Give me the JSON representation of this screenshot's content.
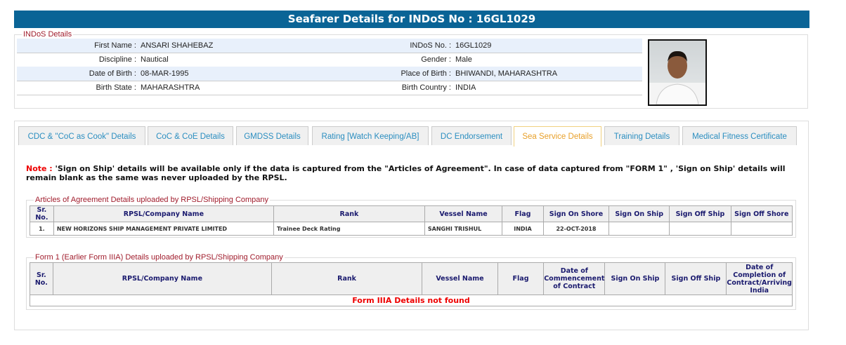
{
  "title": "Seafarer Details for INDoS No : 16GL1029",
  "indos": {
    "legend": "INDoS Details",
    "rows": [
      {
        "l1": "First Name :",
        "v1": "ANSARI SHAHEBAZ",
        "l2": "INDoS No. :",
        "v2": "16GL1029"
      },
      {
        "l1": "Discipline :",
        "v1": "Nautical",
        "l2": "Gender :",
        "v2": "Male"
      },
      {
        "l1": "Date of Birth :",
        "v1": "08-MAR-1995",
        "l2": "Place of Birth :",
        "v2": "BHIWANDI, MAHARASHTRA"
      },
      {
        "l1": "Birth State :",
        "v1": "MAHARASHTRA",
        "l2": "Birth Country :",
        "v2": "INDIA"
      }
    ]
  },
  "tabs": [
    "CDC & \"CoC as Cook\" Details",
    "CoC & CoE Details",
    "GMDSS Details",
    "Rating [Watch Keeping/AB]",
    "DC Endorsement",
    "Sea Service Details",
    "Training Details",
    "Medical Fitness Certificate"
  ],
  "note": {
    "label": "Note :",
    "text": " 'Sign on Ship' details will be available only if the data is captured from the \"Articles of Agreement\". In case of data captured from \"FORM 1\" , 'Sign on Ship' details will remain blank as the same was never uploaded by the RPSL."
  },
  "aoa": {
    "legend": "Articles of Agreement Details uploaded by RPSL/Shipping Company",
    "headers": [
      "Sr. No.",
      "RPSL/Company Name",
      "Rank",
      "Vessel Name",
      "Flag",
      "Sign On Shore",
      "Sign On Ship",
      "Sign Off Ship",
      "Sign Off Shore"
    ],
    "rows": [
      [
        "1.",
        "NEW HORIZONS SHIP MANAGEMENT PRIVATE LIMITED",
        "Trainee Deck Rating",
        "SANGHI TRISHUL",
        "INDIA",
        "22-OCT-2018",
        "",
        "",
        ""
      ]
    ]
  },
  "form1": {
    "legend": "Form 1 (Earlier Form IIIA) Details uploaded by RPSL/Shipping Company",
    "headers": [
      "Sr. No.",
      "RPSL/Company Name",
      "Rank",
      "Vessel Name",
      "Flag",
      "Date of Commencement of Contract",
      "Sign On Ship",
      "Sign Off Ship",
      "Date of Completion of Contract/Arriving India"
    ],
    "empty": "Form IIIA Details not found"
  }
}
